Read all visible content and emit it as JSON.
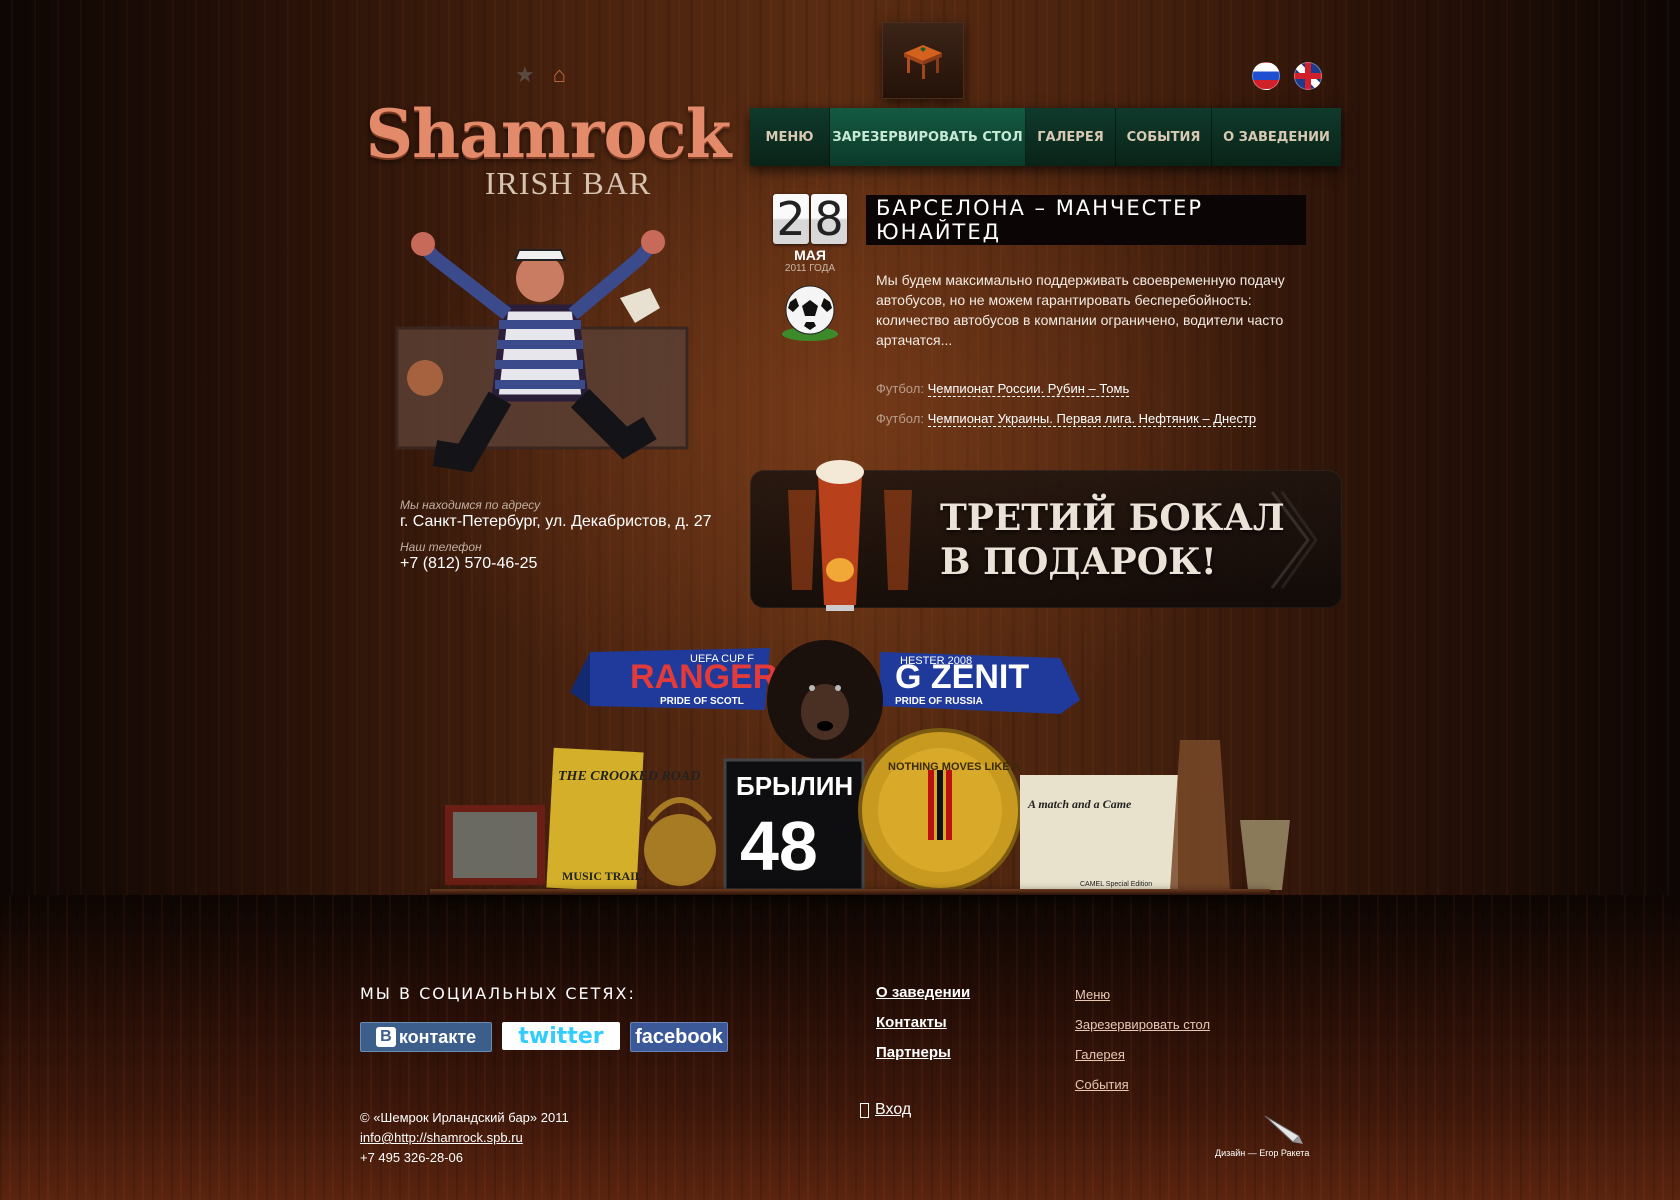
{
  "header": {
    "flags": [
      {
        "name": "russian-flag-icon"
      },
      {
        "name": "uk-flag-icon"
      }
    ]
  },
  "logo": {
    "name": "Shamrock",
    "subtitle": "IRISH BAR"
  },
  "nav": {
    "items": [
      {
        "label": "МЕНЮ",
        "active": false
      },
      {
        "label": "ЗАРЕЗЕРВИРОВАТЬ СТОЛ",
        "active": true
      },
      {
        "label": "ГАЛЕРЕЯ",
        "active": false
      },
      {
        "label": "СОБЫТИЯ",
        "active": false
      },
      {
        "label": "О ЗАВЕДЕНИИ",
        "active": false
      }
    ]
  },
  "contact": {
    "address_label": "Мы находимся по адресу",
    "address": "г. Санкт-Петербург, ул. Декабристов, д. 27",
    "phone_label": "Наш телефон",
    "phone": "+7 (812) 570-46-25"
  },
  "event": {
    "day_d1": "2",
    "day_d2": "8",
    "month": "МАЯ",
    "year": "2011 ГОДА",
    "title": "БАРСЕЛОНА – МАНЧЕСТЕР ЮНАЙТЕД",
    "text": "Мы будем максимально поддерживать своевременную подачу автобусов, но не можем гарантировать бесперебойность: количество автобусов в компании ограничено, водители часто артачатся...",
    "links": [
      {
        "sport": "Футбол:",
        "label": "Чемпионат России. Рубин – Томь"
      },
      {
        "sport": "Футбол:",
        "label": "Чемпионат Украины. Первая лига. Нефтяник – Днестр"
      }
    ]
  },
  "promo": {
    "line1": "ТРЕТИЙ БОКАЛ",
    "line2": "В ПОДАРОК!"
  },
  "shelf": {
    "scarf_left": "RANGERS",
    "scarf_left_top": "UEFA CUP F",
    "scarf_left_bottom": "PRIDE OF SCOTL",
    "scarf_right": "G ZENIT",
    "scarf_right_top": "HESTER 2008",
    "scarf_right_bottom": "PRIDE OF RUSSIA",
    "sign_road": "THE CROOKED ROAD",
    "sign_trail": "MUSIC TRAIL",
    "jersey_name": "БРЫЛИН",
    "jersey_number": "48",
    "medal_text": "NOTHING MOVES LIKE A",
    "poster_text": "A match and a Came",
    "poster_bottom": "CAMEL Special Edition"
  },
  "footer": {
    "social_heading": "МЫ В СОЦИАЛЬНЫХ СЕТЯХ:",
    "vk": "контакте",
    "vk_letter": "B",
    "twitter": "twitter",
    "facebook": "facebook",
    "copyright": "© «Шемрок Ирландский бар» 2011",
    "email": "info@http://shamrock.spb.ru",
    "phone": "+7 495 326-28-06",
    "col1": [
      "О заведении",
      "Контакты",
      "Партнеры"
    ],
    "col2": [
      "Меню",
      "Зарезервировать стол",
      "Галерея",
      "События"
    ],
    "login": "Вход",
    "design_credit": "Дизайн — Егор Ракета"
  },
  "colors": {
    "nav_bg": "#0f3a2c",
    "nav_active": "#145a42",
    "logo": "#e38a6a",
    "wood": "#4a230f"
  }
}
